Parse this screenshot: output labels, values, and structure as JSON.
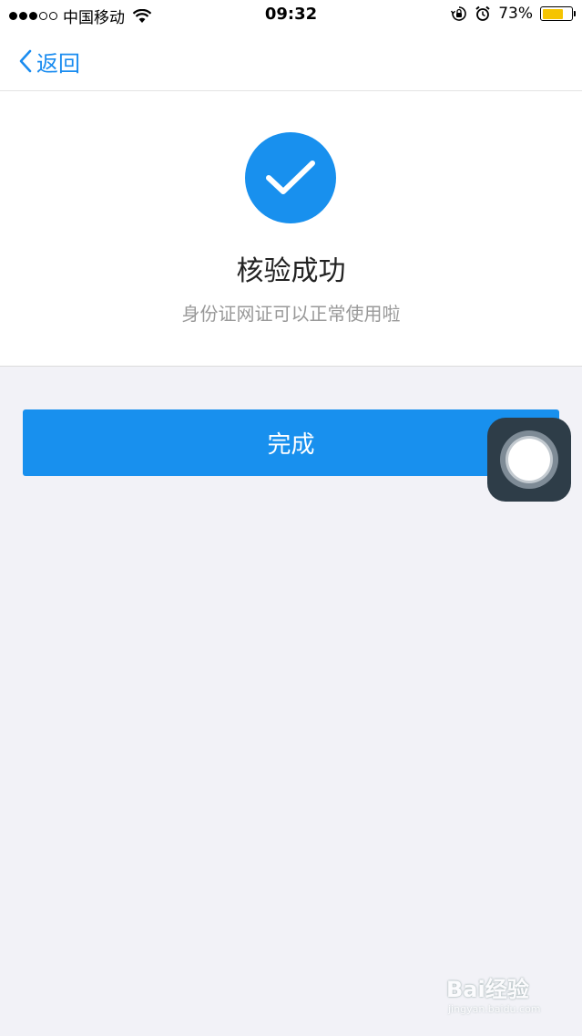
{
  "status_bar": {
    "carrier": "中国移动",
    "time": "09:32",
    "battery": "73%",
    "battery_level": 0.73,
    "signal_bars_filled": 3,
    "signal_bars_total": 5
  },
  "nav": {
    "back_label": "返回"
  },
  "result": {
    "title": "核验成功",
    "subtitle": "身份证网证可以正常使用啦"
  },
  "actions": {
    "done_label": "完成"
  },
  "watermark": {
    "brand": "Bai经验",
    "url": "jingyan.baidu.com"
  },
  "colors": {
    "accent": "#1890ee",
    "background": "#f2f2f7",
    "battery_fill": "#f5c400"
  },
  "icons": {
    "back": "chevron-left-icon",
    "success": "check-circle-icon",
    "wifi": "wifi-icon",
    "orientation_lock": "rotation-lock-icon",
    "alarm": "alarm-clock-icon",
    "assistive_touch": "assistive-touch-icon"
  }
}
